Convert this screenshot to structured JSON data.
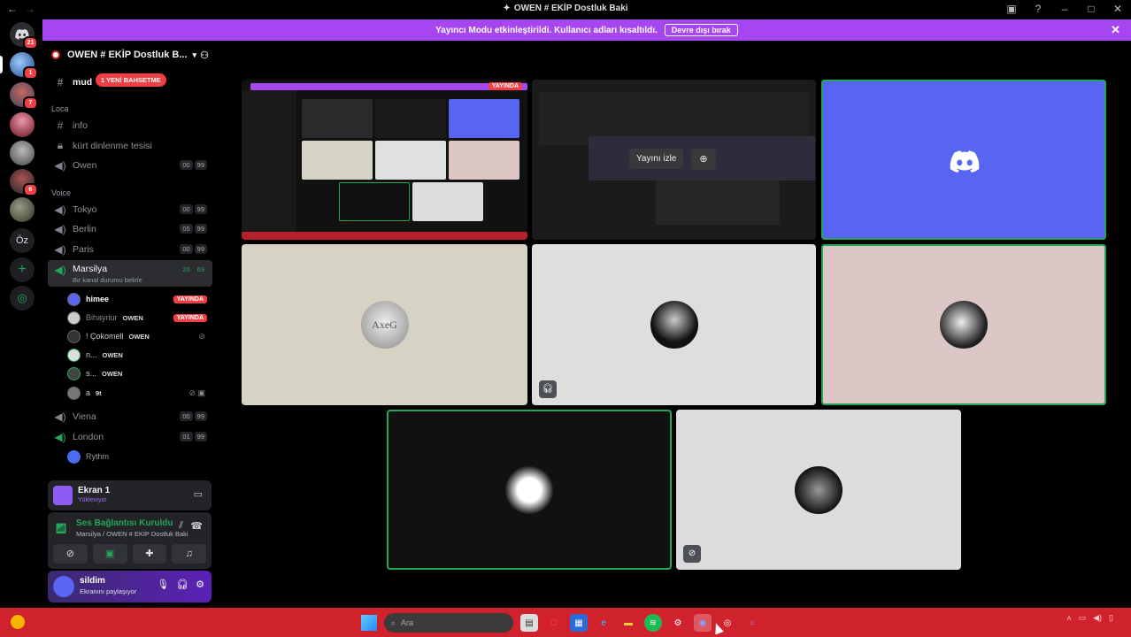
{
  "window": {
    "title": "OWEN # EKİP Dostluk Baki"
  },
  "banner": {
    "text": "Yayıncı Modu etkinleştirildi. Kullanıcı adları kısaltıldı.",
    "disable_label": "Devre dışı bırak"
  },
  "rail": {
    "badges": [
      "21",
      "1",
      "7",
      "6"
    ],
    "text_server": "Öz"
  },
  "guild": {
    "name": "OWEN # EKİP Dostluk B..."
  },
  "channels": {
    "top_channel": "mud",
    "new_messages": "1 YENİ BAHSETME",
    "cat_loca": "Loca",
    "info": "info",
    "kurt": "kürt dinlenme tesisi",
    "owen": "Owen",
    "owen_counts": [
      "00",
      "99"
    ],
    "cat_voice": "Voice",
    "tokyo": "Tokyo",
    "tokyo_counts": [
      "00",
      "99"
    ],
    "berlin": "Berlin",
    "berlin_counts": [
      "05",
      "99"
    ],
    "paris": "Paris",
    "paris_counts": [
      "00",
      "99"
    ],
    "marsilya": "Marsilya",
    "marsilya_counts": [
      "20",
      "69"
    ],
    "marsilya_status": "Bir kanal durumu belirle",
    "viena": "Viena",
    "viena_counts": [
      "00",
      "99"
    ],
    "london": "London",
    "london_counts": [
      "01",
      "99"
    ],
    "rythm": "Rythm"
  },
  "voice_users": [
    {
      "name": "himee",
      "tag": "",
      "live": "YAYINDA"
    },
    {
      "name": "Bihayriur",
      "tag": "OWEN",
      "live": "YAYINDA"
    },
    {
      "name": "! Çokomell",
      "tag": "OWEN",
      "live": ""
    },
    {
      "name": "n...",
      "tag": "OWEN",
      "live": ""
    },
    {
      "name": "s...",
      "tag": "OWEN",
      "live": ""
    },
    {
      "name": "a",
      "tag": "9t",
      "live": ""
    }
  ],
  "screen_panel": {
    "title": "Ekran 1",
    "subtitle": "Yükleniyor"
  },
  "connection": {
    "title": "Ses Bağlantısı Kuruldu",
    "subtitle": "Marsilya / OWEN # EKİP Dostluk Baki"
  },
  "user": {
    "name": "sildim",
    "status": "Ekranını paylaşıyor"
  },
  "stage": {
    "live_label": "YAYINDA",
    "watch_label": "Yayını izle",
    "avatar_text": "AxeG"
  },
  "taskbar": {
    "search_placeholder": "Ara",
    "weather": "",
    "time": "",
    "date": ""
  }
}
